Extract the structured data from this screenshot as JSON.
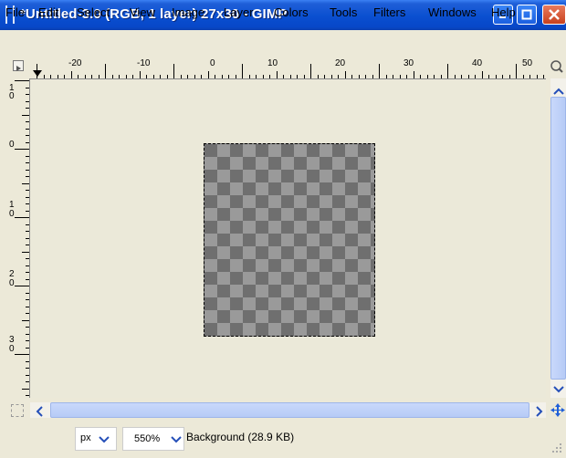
{
  "window": {
    "title": "*Untitled-3.0 (RGB, 1 layer) 27x30 - GIMP",
    "title_color": "#0a4fd0",
    "controls": [
      "minimize-icon",
      "maximize-icon",
      "close-icon"
    ]
  },
  "menubar": {
    "items": [
      "File",
      "Edit",
      "Select",
      "View",
      "Image",
      "Layer",
      "Colors",
      "Tools",
      "Filters",
      "Windows",
      "Help"
    ]
  },
  "ruler_horizontal": {
    "labels": [
      "-20",
      "-10",
      "0",
      "10",
      "20",
      "30",
      "40",
      "50"
    ]
  },
  "ruler_vertical": {
    "labels": [
      "1",
      "0",
      "0",
      "1",
      "0",
      "2",
      "0",
      "3",
      "0"
    ]
  },
  "statusbar": {
    "unit": "px",
    "zoom": "550%",
    "layer_info": "Background (28.9 KB)"
  },
  "colors": {
    "canvas_bg": "#ebe9d9",
    "checker_dark": "#6f6f6f",
    "checker_light": "#9a9a9a"
  }
}
